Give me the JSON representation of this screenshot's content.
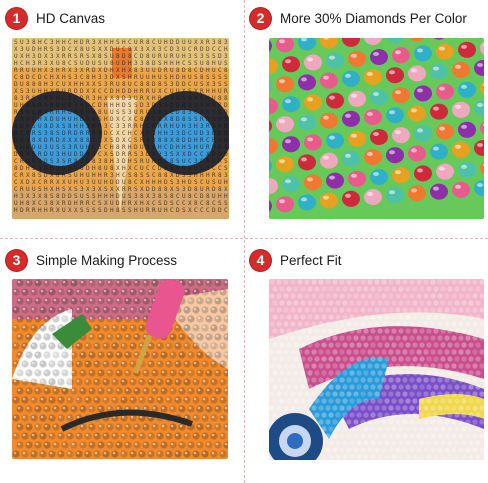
{
  "colors": {
    "badge": "#d42b2b",
    "divider": "#e7b6b6"
  },
  "panels": [
    {
      "number": "1",
      "caption": "HD Canvas"
    },
    {
      "number": "2",
      "caption": "More 30% Diamonds Per Color"
    },
    {
      "number": "3",
      "caption": "Simple Making Process"
    },
    {
      "number": "4",
      "caption": "Perfect Fit"
    }
  ]
}
